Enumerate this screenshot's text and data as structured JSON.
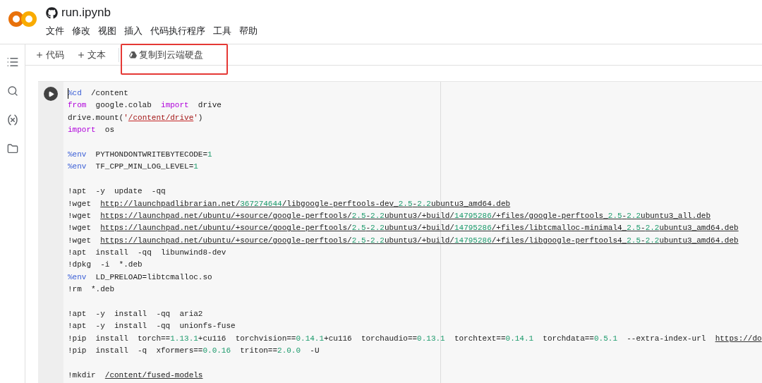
{
  "app": {
    "file_name": "run.ipynb"
  },
  "menu": [
    {
      "label": "文件"
    },
    {
      "label": "修改"
    },
    {
      "label": "视图"
    },
    {
      "label": "插入"
    },
    {
      "label": "代码执行程序"
    },
    {
      "label": "工具"
    },
    {
      "label": "帮助"
    }
  ],
  "toolbar": {
    "add_buttons": [
      {
        "label": "代码"
      },
      {
        "label": "文本"
      }
    ],
    "copy_to_drive": {
      "label": "复制到云端硬盘",
      "highlighted": true
    }
  },
  "cell": {
    "lines": [
      {
        "kind": "code",
        "parts": [
          {
            "kind": "magic",
            "text": "%cd"
          },
          {
            "kind": "plain",
            "text": "  /content"
          }
        ]
      },
      {
        "kind": "code",
        "parts": [
          {
            "kind": "keyword",
            "text": "from"
          },
          {
            "kind": "plain",
            "text": "  google.colab  "
          },
          {
            "kind": "keyword",
            "text": "import"
          },
          {
            "kind": "plain",
            "text": "  drive"
          }
        ]
      },
      {
        "kind": "code",
        "parts": [
          {
            "kind": "plain",
            "text": "drive.mount("
          },
          {
            "kind": "string",
            "text": "'"
          },
          {
            "kind": "link",
            "parts": [
              {
                "kind": "string",
                "text": "/content/drive"
              }
            ]
          },
          {
            "kind": "string",
            "text": "'"
          },
          {
            "kind": "plain",
            "text": ")"
          }
        ]
      },
      {
        "kind": "code",
        "parts": [
          {
            "kind": "keyword",
            "text": "import"
          },
          {
            "kind": "plain",
            "text": "  os"
          }
        ]
      },
      {
        "kind": "blank"
      },
      {
        "kind": "code",
        "parts": [
          {
            "kind": "magic",
            "text": "%env"
          },
          {
            "kind": "plain",
            "text": "  PYTHONDONTWRITEBYTECODE="
          },
          {
            "kind": "number",
            "text": "1"
          }
        ]
      },
      {
        "kind": "code",
        "parts": [
          {
            "kind": "magic",
            "text": "%env"
          },
          {
            "kind": "plain",
            "text": "  TF_CPP_MIN_LOG_LEVEL="
          },
          {
            "kind": "number",
            "text": "1"
          }
        ]
      },
      {
        "kind": "blank"
      },
      {
        "kind": "code",
        "parts": [
          {
            "kind": "plain",
            "text": "!apt  -y  update  -qq"
          }
        ]
      },
      {
        "kind": "code",
        "parts": [
          {
            "kind": "plain",
            "text": "!wget  "
          },
          {
            "kind": "link",
            "parts": [
              {
                "kind": "plain",
                "text": "http://launchpadlibrarian.net/"
              },
              {
                "kind": "number",
                "text": "367274644"
              },
              {
                "kind": "plain",
                "text": "/libgoogle-perftools-dev_"
              },
              {
                "kind": "number",
                "text": "2.5"
              },
              {
                "kind": "plain",
                "text": "-"
              },
              {
                "kind": "number",
                "text": "2.2"
              },
              {
                "kind": "plain",
                "text": "ubuntu3_amd64.deb"
              }
            ]
          }
        ]
      },
      {
        "kind": "code",
        "parts": [
          {
            "kind": "plain",
            "text": "!wget  "
          },
          {
            "kind": "link",
            "parts": [
              {
                "kind": "plain",
                "text": "https://launchpad.net/ubuntu/+source/google-perftools/"
              },
              {
                "kind": "number",
                "text": "2.5"
              },
              {
                "kind": "plain",
                "text": "-"
              },
              {
                "kind": "number",
                "text": "2.2"
              },
              {
                "kind": "plain",
                "text": "ubuntu3/+build/"
              },
              {
                "kind": "number",
                "text": "14795286"
              },
              {
                "kind": "plain",
                "text": "/+files/google-perftools_"
              },
              {
                "kind": "number",
                "text": "2.5"
              },
              {
                "kind": "plain",
                "text": "-"
              },
              {
                "kind": "number",
                "text": "2.2"
              },
              {
                "kind": "plain",
                "text": "ubuntu3_all.deb"
              }
            ]
          }
        ]
      },
      {
        "kind": "code",
        "parts": [
          {
            "kind": "plain",
            "text": "!wget  "
          },
          {
            "kind": "link",
            "parts": [
              {
                "kind": "plain",
                "text": "https://launchpad.net/ubuntu/+source/google-perftools/"
              },
              {
                "kind": "number",
                "text": "2.5"
              },
              {
                "kind": "plain",
                "text": "-"
              },
              {
                "kind": "number",
                "text": "2.2"
              },
              {
                "kind": "plain",
                "text": "ubuntu3/+build/"
              },
              {
                "kind": "number",
                "text": "14795286"
              },
              {
                "kind": "plain",
                "text": "/+files/libtcmalloc-minimal4_"
              },
              {
                "kind": "number",
                "text": "2.5"
              },
              {
                "kind": "plain",
                "text": "-"
              },
              {
                "kind": "number",
                "text": "2.2"
              },
              {
                "kind": "plain",
                "text": "ubuntu3_amd64.deb"
              }
            ]
          }
        ]
      },
      {
        "kind": "code",
        "parts": [
          {
            "kind": "plain",
            "text": "!wget  "
          },
          {
            "kind": "link",
            "parts": [
              {
                "kind": "plain",
                "text": "https://launchpad.net/ubuntu/+source/google-perftools/"
              },
              {
                "kind": "number",
                "text": "2.5"
              },
              {
                "kind": "plain",
                "text": "-"
              },
              {
                "kind": "number",
                "text": "2.2"
              },
              {
                "kind": "plain",
                "text": "ubuntu3/+build/"
              },
              {
                "kind": "number",
                "text": "14795286"
              },
              {
                "kind": "plain",
                "text": "/+files/libgoogle-perftools4_"
              },
              {
                "kind": "number",
                "text": "2.5"
              },
              {
                "kind": "plain",
                "text": "-"
              },
              {
                "kind": "number",
                "text": "2.2"
              },
              {
                "kind": "plain",
                "text": "ubuntu3_amd64.deb"
              }
            ]
          }
        ]
      },
      {
        "kind": "code",
        "parts": [
          {
            "kind": "plain",
            "text": "!apt  install  -qq  libunwind8-dev"
          }
        ]
      },
      {
        "kind": "code",
        "parts": [
          {
            "kind": "plain",
            "text": "!dpkg  -i  *.deb"
          }
        ]
      },
      {
        "kind": "code",
        "parts": [
          {
            "kind": "magic",
            "text": "%env"
          },
          {
            "kind": "plain",
            "text": "  LD_PRELOAD=libtcmalloc.so"
          }
        ]
      },
      {
        "kind": "code",
        "parts": [
          {
            "kind": "plain",
            "text": "!rm  *.deb"
          }
        ]
      },
      {
        "kind": "blank"
      },
      {
        "kind": "code",
        "parts": [
          {
            "kind": "plain",
            "text": "!apt  -y  install  -qq  aria2"
          }
        ]
      },
      {
        "kind": "code",
        "parts": [
          {
            "kind": "plain",
            "text": "!apt  -y  install  -qq  unionfs-fuse"
          }
        ]
      },
      {
        "kind": "code",
        "parts": [
          {
            "kind": "plain",
            "text": "!pip  install  torch=="
          },
          {
            "kind": "number",
            "text": "1.13.1"
          },
          {
            "kind": "plain",
            "text": "+cu116  torchvision=="
          },
          {
            "kind": "number",
            "text": "0.14.1"
          },
          {
            "kind": "plain",
            "text": "+cu116  torchaudio=="
          },
          {
            "kind": "number",
            "text": "0.13.1"
          },
          {
            "kind": "plain",
            "text": "  torchtext=="
          },
          {
            "kind": "number",
            "text": "0.14.1"
          },
          {
            "kind": "plain",
            "text": "  torchdata=="
          },
          {
            "kind": "number",
            "text": "0.5.1"
          },
          {
            "kind": "plain",
            "text": "  --extra-index-url  "
          },
          {
            "kind": "link",
            "parts": [
              {
                "kind": "plain",
                "text": "https://do"
              }
            ]
          }
        ]
      },
      {
        "kind": "code",
        "parts": [
          {
            "kind": "plain",
            "text": "!pip  install  -q  xformers=="
          },
          {
            "kind": "number",
            "text": "0.0.16"
          },
          {
            "kind": "plain",
            "text": "  triton=="
          },
          {
            "kind": "number",
            "text": "2.0.0"
          },
          {
            "kind": "plain",
            "text": "  -U"
          }
        ]
      },
      {
        "kind": "blank"
      },
      {
        "kind": "code",
        "parts": [
          {
            "kind": "plain",
            "text": "!mkdir  "
          },
          {
            "kind": "link",
            "parts": [
              {
                "kind": "plain",
                "text": "/content/fused-models"
              }
            ]
          }
        ]
      }
    ]
  }
}
